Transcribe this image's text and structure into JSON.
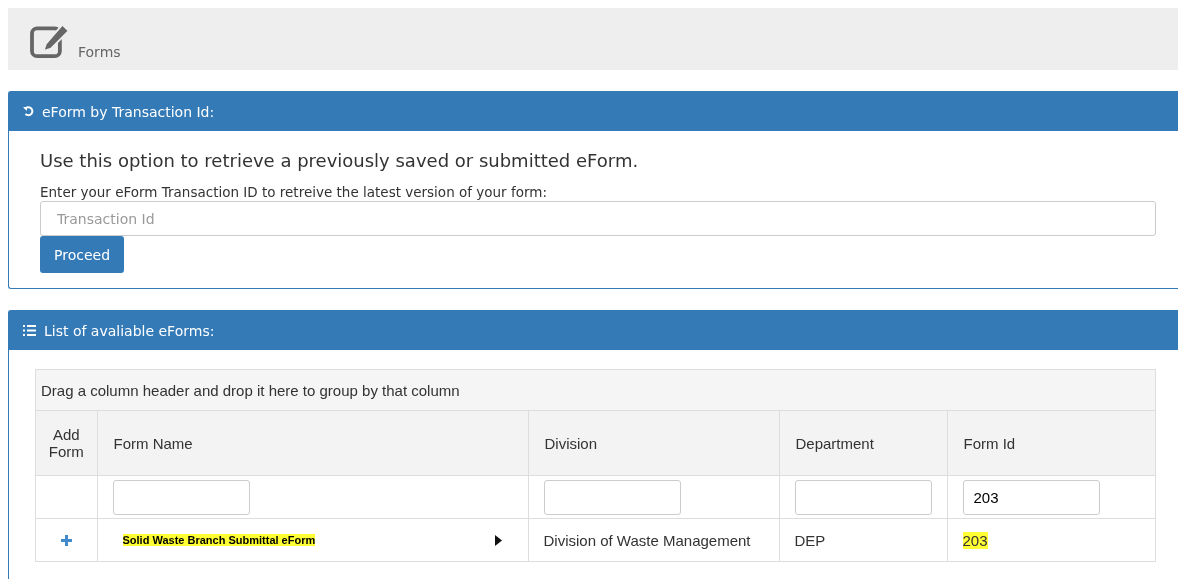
{
  "page_header": {
    "title": "Forms"
  },
  "transaction_panel": {
    "title": "eForm by Transaction Id:",
    "lead": "Use this option to retrieve a previously saved or submitted eForm.",
    "instruction": "Enter your eForm Transaction ID to retreive the latest version of your form:",
    "field": {
      "placeholder": "Transaction Id"
    },
    "button": "Proceed"
  },
  "forms_panel": {
    "title": "List of avaliable eForms:",
    "group_hint": "Drag a column header and drop it here to group by that column",
    "table": {
      "columns": [
        {
          "label": "Add Form",
          "filter": false
        },
        {
          "label": "Form Name",
          "filter": true
        },
        {
          "label": "Division",
          "filter": true
        },
        {
          "label": "Department",
          "filter": true
        },
        {
          "label": "Form Id",
          "filter": true,
          "filter_value": "203"
        }
      ],
      "rows": [
        {
          "cells": [
            {
              "kind": "add"
            },
            {
              "kind": "name",
              "text": "Solid Waste Branch Submittal eForm",
              "highlighted": true
            },
            {
              "kind": "text",
              "text": "Division of Waste Management",
              "highlighted": false
            },
            {
              "kind": "text",
              "text": "DEP",
              "highlighted": false
            },
            {
              "kind": "text",
              "text": "203",
              "highlighted": true
            }
          ]
        }
      ]
    }
  }
}
